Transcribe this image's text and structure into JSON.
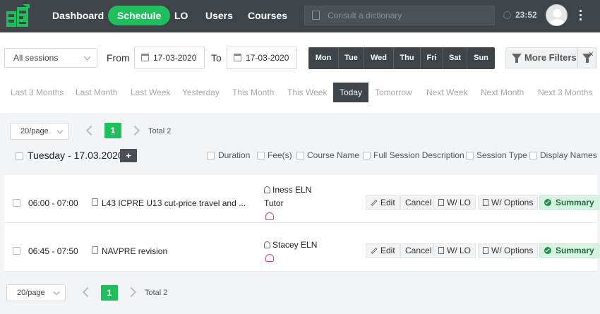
{
  "nav": {
    "items": [
      "Dashboard",
      "Schedule",
      "LO",
      "Users",
      "Courses"
    ],
    "active": "Schedule",
    "dictionary_placeholder": "Consult a dictionary",
    "time": "23:52"
  },
  "filters": {
    "session_select": "All sessions",
    "from_label": "From",
    "from_date": "17-03-2020",
    "to_label": "To",
    "to_date": "17-03-2020",
    "days": [
      "Mon",
      "Tue",
      "Wed",
      "Thu",
      "Fri",
      "Sat",
      "Sun"
    ],
    "more_filters": "More Filters",
    "quick_ranges": [
      "Last 3 Months",
      "Last Month",
      "Last Week",
      "Yesterday",
      "This Month",
      "This Week",
      "Today",
      "Tomorrow",
      "Next Week",
      "Next Month",
      "Next 3 Months"
    ],
    "active_range": "Today"
  },
  "pagination": {
    "per_page": "20/page",
    "page": "1",
    "total": "Total 2"
  },
  "day_group": {
    "title": "Tuesday - 17.03.2020",
    "add": "+",
    "options": [
      "Duration",
      "Fee(s)",
      "Course Name",
      "Full Session Description",
      "Session Type",
      "Display Names"
    ]
  },
  "actions": {
    "edit": "Edit",
    "cancel": "Cancel",
    "with_lo": "W/ LO",
    "with_options": "W/ Options",
    "summary": "Summary"
  },
  "sessions": [
    {
      "time": "06:00 - 07:00",
      "title": "L43 ICPRE U13 cut-price travel and ...",
      "tutor": "Iness ELN",
      "role": "Tutor"
    },
    {
      "time": "06:45 - 07:50",
      "title": "NAVPRE revision",
      "tutor": "Stacey ELN",
      "role": ""
    }
  ]
}
